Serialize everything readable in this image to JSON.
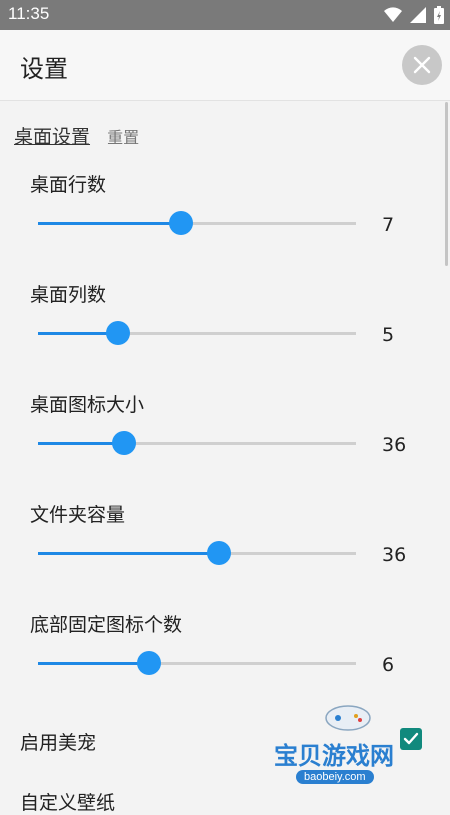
{
  "status_bar": {
    "time": "11:35",
    "icons": [
      "wifi-icon",
      "signal-icon",
      "battery-icon"
    ]
  },
  "app_bar": {
    "title": "设置",
    "close_icon": "close-icon"
  },
  "section": {
    "title": "桌面设置",
    "reset": "重置"
  },
  "settings": [
    {
      "label": "桌面行数",
      "value": "7",
      "fraction": 0.45
    },
    {
      "label": "桌面列数",
      "value": "5",
      "fraction": 0.25
    },
    {
      "label": "桌面图标大小",
      "value": "36",
      "fraction": 0.27
    },
    {
      "label": "文件夹容量",
      "value": "36",
      "fraction": 0.57
    },
    {
      "label": "底部固定图标个数",
      "value": "6",
      "fraction": 0.35
    }
  ],
  "toggle": {
    "label": "启用美宠",
    "checked": true
  },
  "next_item": {
    "label": "自定义壁纸"
  },
  "watermark": {
    "text": "宝贝游戏网",
    "url": "baobeiy.com"
  },
  "colors": {
    "accent": "#2196f3",
    "checkbox": "#11897d",
    "status_bar": "#7a7a7a"
  }
}
